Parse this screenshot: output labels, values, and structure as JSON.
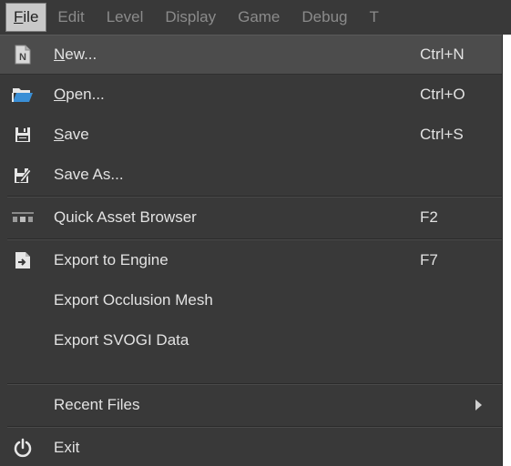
{
  "menubar": {
    "items": [
      {
        "label": "File",
        "mnemonic_first": "F",
        "rest": "ile",
        "active": true
      },
      {
        "label": "Edit"
      },
      {
        "label": "Level"
      },
      {
        "label": "Display"
      },
      {
        "label": "Game"
      },
      {
        "label": "Debug"
      },
      {
        "label": "T"
      }
    ]
  },
  "file_menu": {
    "new": {
      "mnemonic": "N",
      "rest": "ew...",
      "shortcut": "Ctrl+N",
      "icon": "new-file-icon"
    },
    "open": {
      "mnemonic": "O",
      "rest": "pen...",
      "shortcut": "Ctrl+O",
      "icon": "open-folder-icon"
    },
    "save": {
      "mnemonic": "S",
      "rest": "ave",
      "shortcut": "Ctrl+S",
      "icon": "floppy-disk-icon"
    },
    "save_as": {
      "label": "Save As...",
      "icon": "save-as-icon"
    },
    "quick_asset_browser": {
      "label": "Quick Asset Browser",
      "shortcut": "F2",
      "icon": "asset-browser-icon"
    },
    "export_to_engine": {
      "label": "Export to Engine",
      "shortcut": "F7",
      "icon": "export-icon"
    },
    "export_occlusion_mesh": {
      "label": "Export Occlusion Mesh"
    },
    "export_svogi_data": {
      "label": "Export SVOGI Data"
    },
    "recent_files": {
      "label": "Recent Files"
    },
    "exit": {
      "label": "Exit",
      "icon": "power-icon"
    }
  },
  "colors": {
    "menu_bg": "#393939",
    "highlight_bg": "#4c4c4c",
    "text": "#e2e2e2",
    "menubar_inactive_text": "#8b8b8b",
    "active_tab_bg": "#c9c9c9"
  }
}
